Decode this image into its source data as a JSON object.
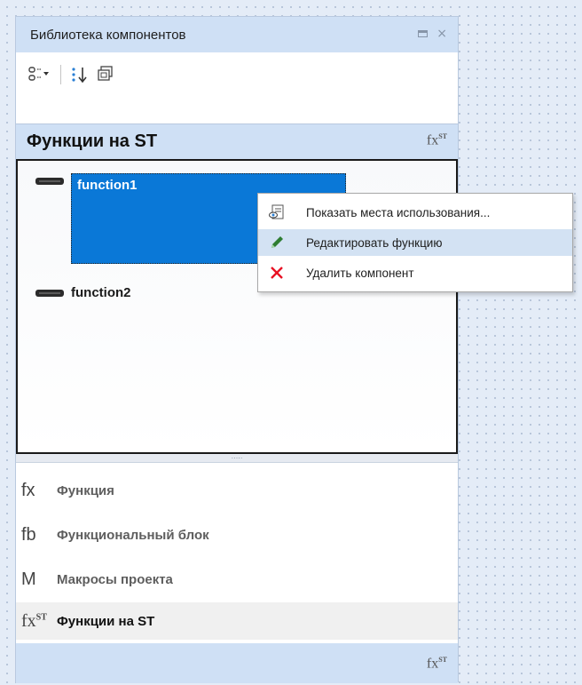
{
  "panel": {
    "title": "Библиотека компонентов",
    "close_glyph": "×"
  },
  "toolbar": {
    "buttons": [
      "view-list-icon",
      "sort-icon",
      "copy-icon"
    ]
  },
  "section": {
    "title": "Функции на ST",
    "icon_main": "fx",
    "icon_sup": "ST"
  },
  "functions": [
    {
      "label": "function1",
      "selected": true
    },
    {
      "label": "function2",
      "selected": false
    }
  ],
  "splitter": {
    "grip": "....."
  },
  "categories": [
    {
      "icon": "fx",
      "label": "Функция"
    },
    {
      "icon": "fb",
      "label": "Функциональный блок"
    },
    {
      "icon": "M",
      "label": "Макросы проекта"
    },
    {
      "icon": "fx",
      "icon_sup": "ST",
      "label": "Функции на ST",
      "active": true
    }
  ],
  "context_menu": {
    "items": [
      {
        "label": "Показать места использования...",
        "icon": "show-usages-icon"
      },
      {
        "label": "Редактировать функцию",
        "icon": "pencil-icon",
        "hover": true
      },
      {
        "label": "Удалить компонент",
        "icon": "delete-x-icon"
      }
    ]
  },
  "colors": {
    "accent": "#0a78d7",
    "header_bg": "#cfe0f5",
    "menu_hover": "#d3e2f3",
    "delete_red": "#e81123",
    "pencil_green": "#2e7d32"
  }
}
